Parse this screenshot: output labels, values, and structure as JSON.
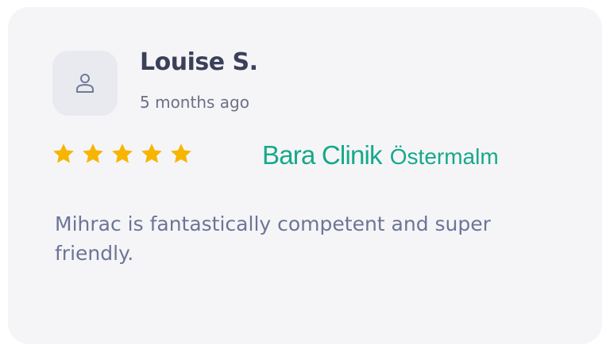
{
  "review": {
    "author": "Louise S.",
    "posted": "5 months ago",
    "rating": 5,
    "rating_max": 5,
    "clinic_name": "Bara Clinik",
    "clinic_area": "Östermalm",
    "text": "Mihrac is fantastically competent and super friendly."
  },
  "icons": {
    "avatar": "user-icon",
    "star": "star-icon"
  },
  "colors": {
    "card_bg": "#f5f5f8",
    "star": "#f7b500",
    "clinic": "#16a98b",
    "text": "#6c7596",
    "title": "#3b4059"
  }
}
